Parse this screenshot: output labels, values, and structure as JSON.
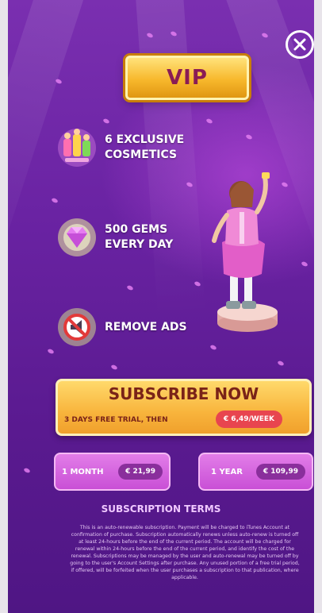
{
  "header": {
    "badge": "VIP"
  },
  "perks": [
    {
      "icon": "cosmetics-icon",
      "line1": "6 EXCLUSIVE",
      "line2": "COSMETICS"
    },
    {
      "icon": "gem-icon",
      "line1": "500 GEMS",
      "line2": "EVERY DAY"
    },
    {
      "icon": "no-ads-icon",
      "line1": "REMOVE ADS",
      "line2": ""
    }
  ],
  "subscribe": {
    "title": "SUBSCRIBE NOW",
    "trial": "3 DAYS FREE TRIAL, THEN",
    "price": "€ 6,49/WEEK"
  },
  "plans": [
    {
      "label": "1 MONTH",
      "price": "€ 21,99"
    },
    {
      "label": "1 YEAR",
      "price": "€ 109,99"
    }
  ],
  "terms": {
    "title": "SUBSCRIPTION TERMS",
    "body": "This is an auto-renewable subscription. Payment will be charged to iTunes Account at confirmation of purchase. Subscription automatically renews unless auto-renew is turned off at least 24-hours before the end of the current period. The account will be charged for renewal within 24-hours before the end of the current period, and identify the cost of the renewal. Subscriptions may be managed by the user and auto-renewal may be turned off by going to the user's Account Settings after purchase. Any unused portion of a free trial period, if offered, will be forfeited when the user purchases a subscription to that publication, where applicable."
  },
  "colors": {
    "background": "#6a23a3",
    "gold": "#f7b82c",
    "pink_button": "#d561e0",
    "price_red": "#e8454f"
  }
}
